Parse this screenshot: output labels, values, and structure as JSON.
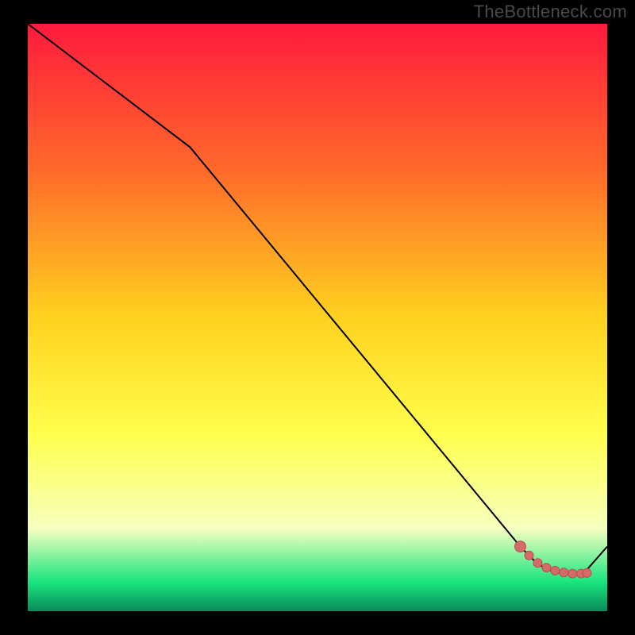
{
  "watermark": "TheBottleneck.com",
  "colors": {
    "bg_black": "#000000",
    "line": "#000000",
    "marker_fill": "#d66a6a",
    "marker_stroke": "#b85050",
    "grad_top": "#ff1a3d",
    "grad_mid_top": "#ff6a2a",
    "grad_mid": "#ffd21f",
    "grad_mid_low": "#ffff4d",
    "grad_low": "#f6ffbf",
    "grad_green": "#19e57f",
    "grad_bottom": "#0a8b5a"
  },
  "chart_data": {
    "type": "line",
    "title": "",
    "xlabel": "",
    "ylabel": "",
    "xlim": [
      0,
      100
    ],
    "ylim": [
      0,
      100
    ],
    "series": [
      {
        "name": "curve",
        "x": [
          0,
          28,
          85,
          88,
          90,
          92,
          94,
          96,
          100
        ],
        "y": [
          100,
          79,
          11,
          8,
          7,
          6.5,
          6.4,
          6.5,
          11
        ]
      }
    ],
    "markers": {
      "name": "highlight-points",
      "x": [
        85,
        86.5,
        88,
        89.5,
        91,
        92.5,
        94,
        95.5,
        96.5
      ],
      "y": [
        11,
        9.5,
        8.2,
        7.4,
        6.9,
        6.6,
        6.4,
        6.4,
        6.5
      ]
    }
  }
}
